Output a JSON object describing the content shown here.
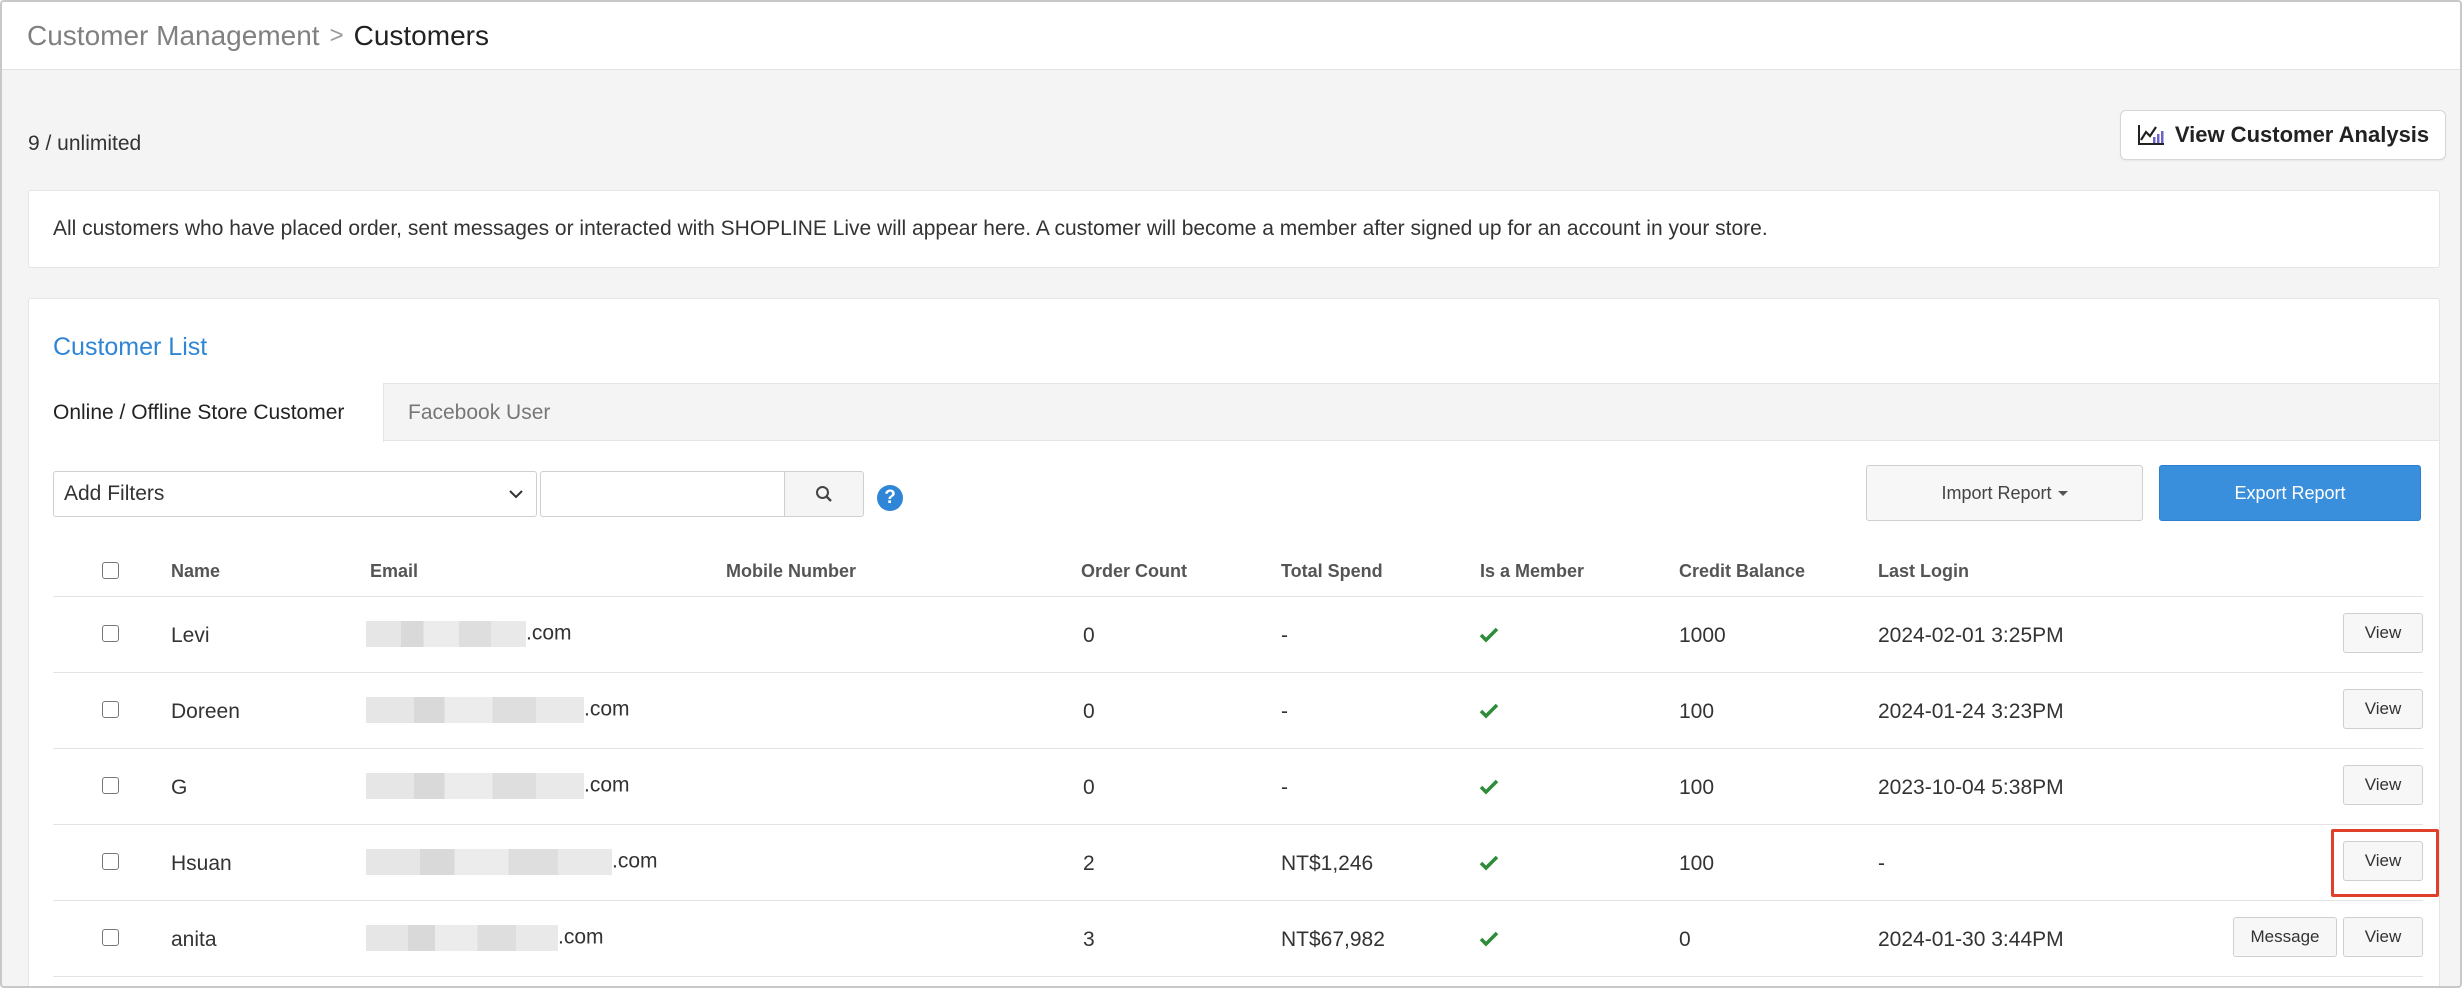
{
  "breadcrumb": {
    "parent": "Customer Management",
    "separator": ">",
    "current": "Customers"
  },
  "quota": "9 / unlimited",
  "analysis_button": {
    "label": "View Customer Analysis",
    "icon": "chart-icon"
  },
  "notice": "All customers who have placed order, sent messages or interacted with SHOPLINE Live will appear here. A customer will become a member after signed up for an account in your store.",
  "panel": {
    "title": "Customer List",
    "tabs": [
      {
        "label": "Online / Offline Store Customer",
        "active": true
      },
      {
        "label": "Facebook User",
        "active": false
      }
    ]
  },
  "toolbar": {
    "filter_label": "Add Filters",
    "search_placeholder": "",
    "help_glyph": "?",
    "import_label": "Import Report",
    "export_label": "Export Report"
  },
  "table": {
    "columns": [
      "Name",
      "Email",
      "Mobile Number",
      "Order Count",
      "Total Spend",
      "Is a Member",
      "Credit Balance",
      "Last Login"
    ],
    "rows": [
      {
        "name": "Levi",
        "email_suffix": ".com",
        "mobile": "",
        "orders": "0",
        "spend": "-",
        "member": true,
        "credit": "1000",
        "last_login": "2024-02-01 3:25PM",
        "view_label": "View",
        "message_label": ""
      },
      {
        "name": "Doreen",
        "email_suffix": ".com",
        "mobile": "",
        "orders": "0",
        "spend": "-",
        "member": true,
        "credit": "100",
        "last_login": "2024-01-24 3:23PM",
        "view_label": "View",
        "message_label": ""
      },
      {
        "name": "G",
        "email_suffix": ".com",
        "mobile": "",
        "orders": "0",
        "spend": "-",
        "member": true,
        "credit": "100",
        "last_login": "2023-10-04 5:38PM",
        "view_label": "View",
        "message_label": ""
      },
      {
        "name": "Hsuan",
        "email_suffix": ".com",
        "mobile": "",
        "orders": "2",
        "spend": "NT$1,246",
        "member": true,
        "credit": "100",
        "last_login": "-",
        "view_label": "View",
        "message_label": ""
      },
      {
        "name": "anita",
        "email_suffix": ".com",
        "mobile": "",
        "orders": "3",
        "spend": "NT$67,982",
        "member": true,
        "credit": "0",
        "last_login": "2024-01-30 3:44PM",
        "view_label": "View",
        "message_label": "Message"
      }
    ]
  },
  "colors": {
    "accent": "#2f86d6",
    "export": "#3a8fdd",
    "check": "#2e8b3a",
    "highlight": "#e0402a"
  }
}
